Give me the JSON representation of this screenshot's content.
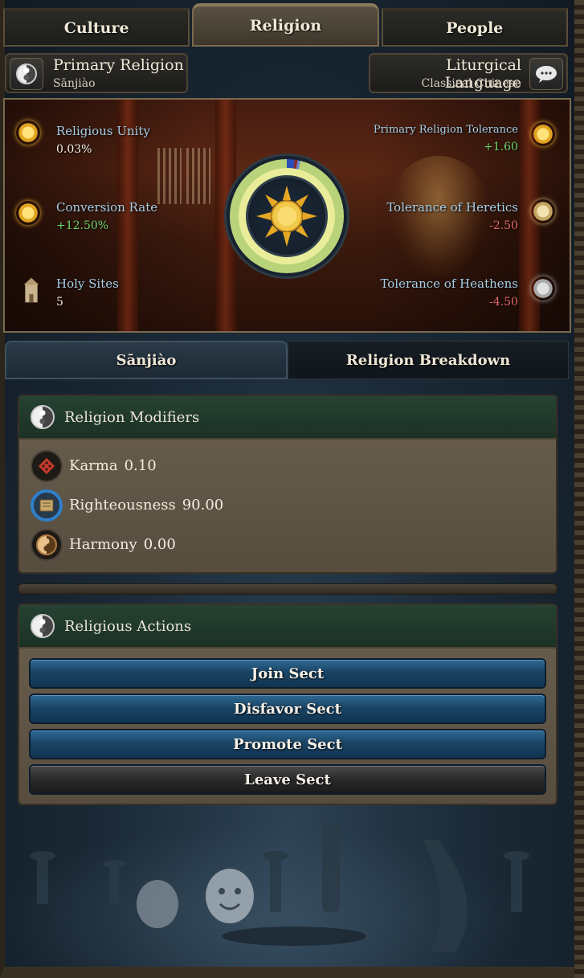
{
  "tabs": [
    {
      "label": "Culture",
      "active": false
    },
    {
      "label": "Religion",
      "active": true
    },
    {
      "label": "People",
      "active": false
    }
  ],
  "primary_religion": {
    "title": "Primary Religion",
    "value": "Sānjiào",
    "icon": "yin-yang-icon"
  },
  "liturgical_language": {
    "title": "Liturgical Language",
    "value": "Classical Chinese",
    "icon": "speech-bubble-icon"
  },
  "stats": {
    "religious_unity": {
      "label": "Religious Unity",
      "value": "0.03%"
    },
    "conversion_rate": {
      "label": "Conversion Rate",
      "value": "+12.50%"
    },
    "holy_sites": {
      "label": "Holy Sites",
      "value": "5"
    },
    "primary_tolerance": {
      "label": "Primary Religion Tolerance",
      "value": "+1.60"
    },
    "heretics_tolerance": {
      "label": "Tolerance of Heretics",
      "value": "-2.50"
    },
    "heathens_tolerance": {
      "label": "Tolerance of Heathens",
      "value": "-4.50"
    }
  },
  "subtabs": [
    {
      "label": "Sānjiào",
      "active": true
    },
    {
      "label": "Religion Breakdown",
      "active": false
    }
  ],
  "modifiers": {
    "title": "Religion Modifiers",
    "items": [
      {
        "name": "Karma",
        "value": "0.10",
        "icon": "karma-knot-icon"
      },
      {
        "name": "Righteousness",
        "value": "90.00",
        "icon": "scroll-icon"
      },
      {
        "name": "Harmony",
        "value": "0.00",
        "icon": "yin-yang-icon"
      }
    ]
  },
  "actions": {
    "title": "Religious Actions",
    "buttons": [
      "Join Sect",
      "Disfavor Sect",
      "Promote Sect",
      "Leave Sect"
    ]
  },
  "colors": {
    "positive": "#6fd46a",
    "negative": "#e66a6a",
    "label_blue": "#a8cfe6",
    "button_blue": "#1a4464",
    "header_green": "#264232"
  }
}
